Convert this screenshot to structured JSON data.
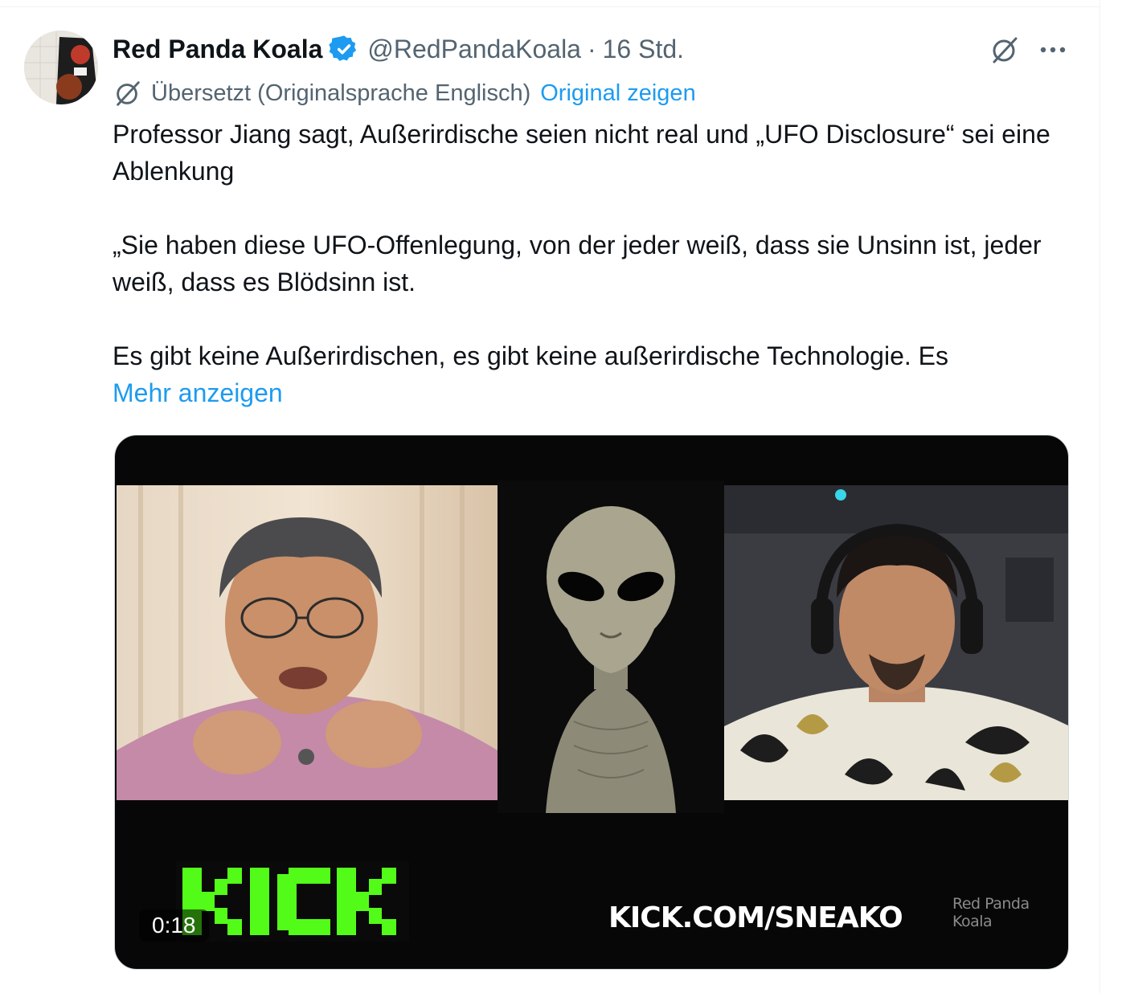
{
  "tweet": {
    "author_name": "Red Panda Koala",
    "handle": "@RedPandaKoala",
    "separator": "·",
    "time": "16 Std.",
    "translation_label": "Übersetzt (Originalsprache Englisch)",
    "show_original": "Original zeigen",
    "text_1": "Professor Jiang sagt, Außerirdische seien nicht real und „UFO Disclosure“ sei eine Ablenkung",
    "text_2": "„Sie haben diese UFO-Offenlegung, von der jeder weiß, dass sie Unsinn ist, jeder weiß, dass es Blödsinn ist.",
    "text_3": "Es gibt keine Außerirdischen, es gibt keine außerirdische Technologie. Es",
    "show_more": "Mehr anzeigen",
    "more_menu": "···"
  },
  "media": {
    "duration": "0:18",
    "kick_logo_text": "KICK",
    "kick_url": "KICK.COM/SNEAKO",
    "watermark": "Red Panda Koala"
  },
  "icons": {
    "verified": "verified-badge-icon",
    "grok": "grok-icon",
    "translate": "translate-icon",
    "more": "more-icon"
  },
  "colors": {
    "link": "#1d9bf0",
    "secondary_text": "#536471",
    "primary_text": "#0f1419",
    "kick_green": "#53fc18"
  }
}
